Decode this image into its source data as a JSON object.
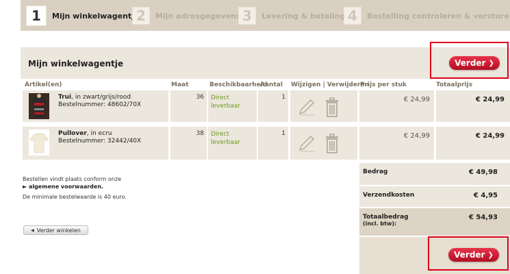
{
  "steps": [
    {
      "num": "1",
      "label": "Mijn winkelwagentje"
    },
    {
      "num": "2",
      "label": "Mijn adresgegevens"
    },
    {
      "num": "3",
      "label": "Levering & betaling"
    },
    {
      "num": "4",
      "label": "Bestelling controleren & versturen"
    }
  ],
  "cart": {
    "title": "Mijn winkelwagentje",
    "continue_label": "Verder"
  },
  "columns": {
    "article": "Artikel(en)",
    "size": "Maat",
    "availability": "Beschikbaarheid",
    "quantity": "Aantal",
    "edit_delete": "Wijzigen | Verwijderen",
    "unit_price": "Prijs per stuk",
    "total_price": "Totaalprijs"
  },
  "items": [
    {
      "name": "Trui",
      "desc": ", in zwart/grijs/rood",
      "order_no": "Bestelnummer: 48602/70X",
      "size": "36",
      "avail_1": "Direct",
      "avail_2": "leverbaar",
      "qty": "1",
      "unit_price": "€ 24,99",
      "total": "€ 24,99"
    },
    {
      "name": "Pullover",
      "desc": ", in ecru",
      "order_no": "Bestelnummer: 32442/40X",
      "size": "38",
      "avail_1": "Direct",
      "avail_2": "leverbaar",
      "qty": "1",
      "unit_price": "€ 24,99",
      "total": "€ 24,99"
    }
  ],
  "info": {
    "line1": "Bestellen vindt plaats conform onze",
    "line2": "► algemene voorwaarden.",
    "line3": "De minimale bestelwaarde is 40 euro."
  },
  "summary": {
    "amount_label": "Bedrag",
    "amount": "€ 49,98",
    "shipping_label": "Verzendkosten",
    "shipping": "€ 4,95",
    "total_label": "Totaalbedrag",
    "total_sub": "(incl. btw):",
    "total": "€ 54,93"
  },
  "back_label": "Verder winkelen",
  "colors": {
    "accent_red": "#c8102e",
    "panel": "#ece7dd",
    "steps_bg": "#d9d0c2"
  }
}
